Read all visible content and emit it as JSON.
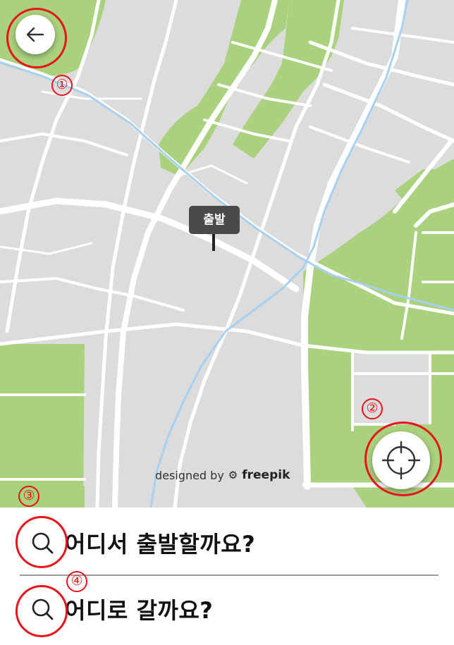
{
  "map": {
    "start_marker_label": "출발",
    "credit_prefix": "designed by",
    "credit_brand": "freepik"
  },
  "buttons": {
    "back_icon": "arrow-left-icon",
    "locate_icon": "crosshair-icon"
  },
  "search": {
    "origin_placeholder": "어디서 출발할까요?",
    "destination_placeholder": "어디로 갈까요?",
    "icon": "search-icon"
  },
  "annotations": {
    "label_1": "①",
    "label_2": "②",
    "label_3": "③",
    "label_4": "④"
  },
  "colors": {
    "map_background": "#dcdcdc",
    "park_green": "#a9d17e",
    "road_white": "#ffffff",
    "river_blue": "#a8d0f0",
    "annotation_red": "#e8141b",
    "marker_gray": "#4a4a4a"
  }
}
